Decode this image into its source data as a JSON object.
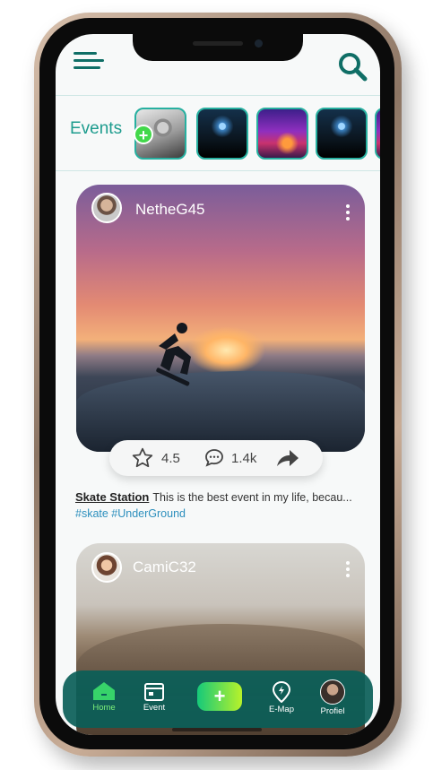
{
  "header": {
    "events_label": "Events"
  },
  "stories": [
    {
      "name": "story-user-1",
      "type": "face"
    },
    {
      "name": "story-concert-1",
      "type": "concert"
    },
    {
      "name": "story-city-night",
      "type": "city"
    },
    {
      "name": "story-concert-2",
      "type": "concert"
    }
  ],
  "posts": [
    {
      "username": "NetheG45",
      "rating": "4.5",
      "comments": "1.4k",
      "title": "Skate Station",
      "description": "This is the best event in my life, becau...",
      "tags": "#skate #UnderGround"
    },
    {
      "username": "CamiC32"
    }
  ],
  "nav": {
    "home": "Home",
    "event": "Event",
    "add": "+",
    "emap": "E-Map",
    "profile": "Profiel"
  },
  "colors": {
    "accent": "#1d9c8e",
    "nav_bg": "#0a5e58",
    "add_button_start": "#16c97a",
    "add_button_end": "#b8f22a",
    "home_active": "#7cf07a"
  }
}
